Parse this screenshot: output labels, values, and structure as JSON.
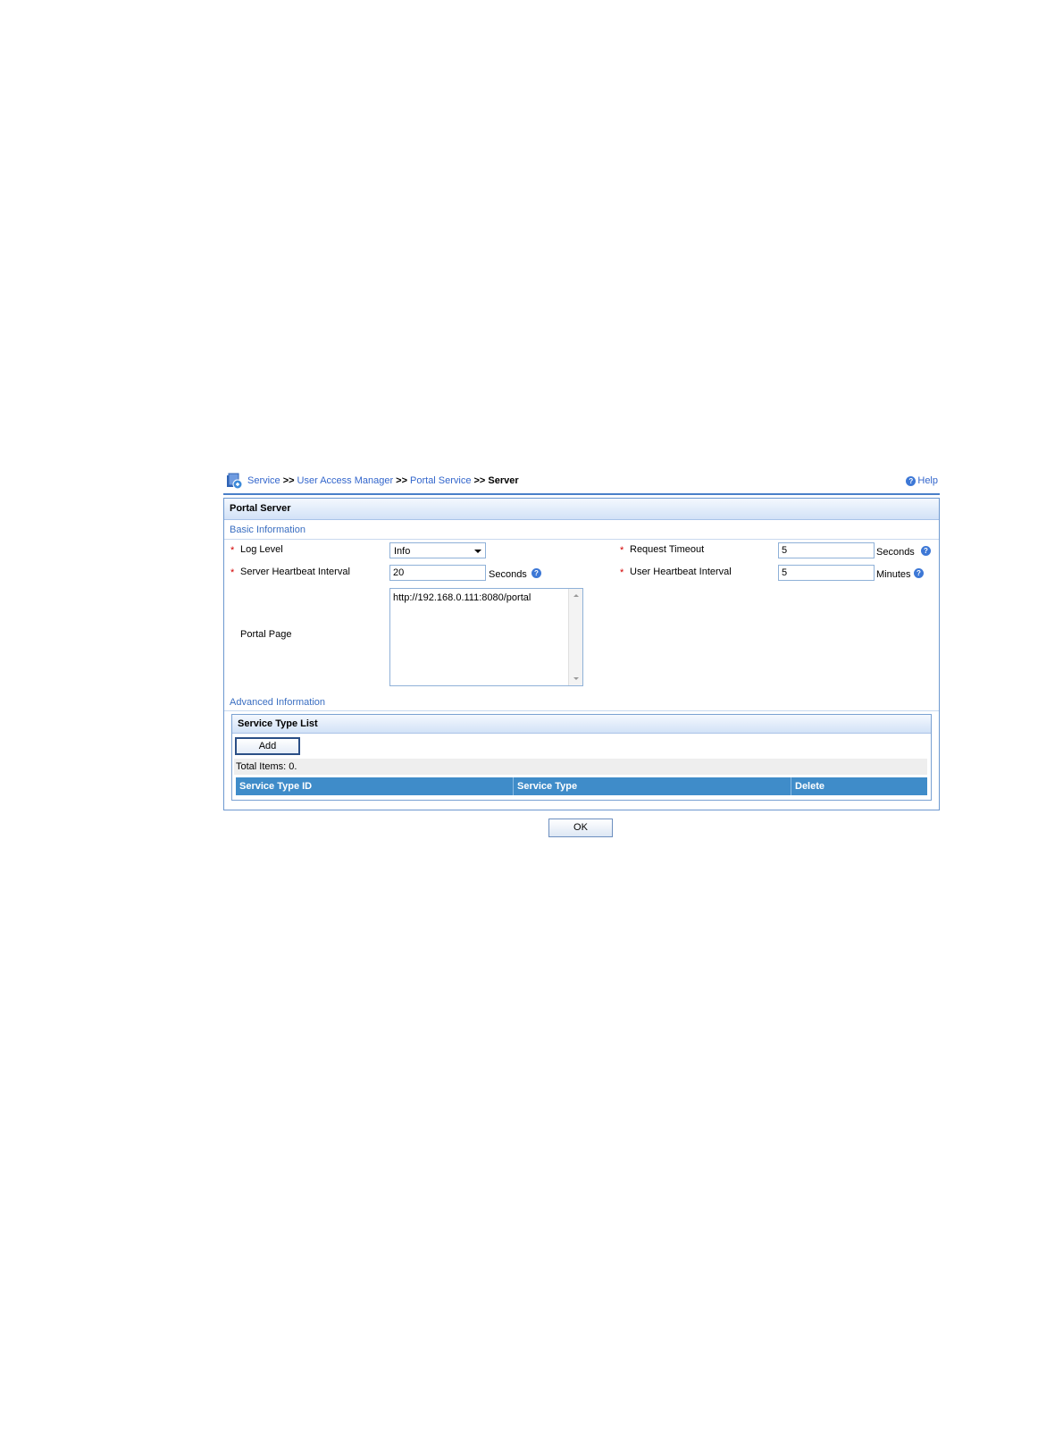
{
  "breadcrumb": {
    "items": [
      "Service",
      "User Access Manager",
      "Portal Service"
    ],
    "separator": ">>",
    "current": "Server"
  },
  "help": {
    "label": "Help"
  },
  "panel": {
    "title": "Portal Server"
  },
  "basic": {
    "title": "Basic Information",
    "required_mark": "*",
    "log_level": {
      "label": "Log Level",
      "value": "Info"
    },
    "request_timeout": {
      "label": "Request Timeout",
      "value": "5",
      "unit": "Seconds"
    },
    "server_heartbeat": {
      "label": "Server Heartbeat Interval",
      "value": "20",
      "unit": "Seconds"
    },
    "user_heartbeat": {
      "label": "User Heartbeat Interval",
      "value": "5",
      "unit": "Minutes"
    },
    "portal_page": {
      "label": "Portal Page",
      "value": "http://192.168.0.111:8080/portal"
    }
  },
  "advanced": {
    "title": "Advanced Information",
    "service_type_list": {
      "title": "Service Type List",
      "add_label": "Add",
      "total": "Total Items: 0.",
      "columns": [
        "Service Type ID",
        "Service Type",
        "Delete"
      ]
    }
  },
  "ok_label": "OK",
  "colors": {
    "accent": "#3366cc",
    "header_blue": "#3f8cc9",
    "border": "#6d98cf",
    "required": "#d30000"
  },
  "icons": {
    "crumb": "portal-service-icon",
    "help": "help-icon",
    "hint": "question-hint-icon"
  }
}
